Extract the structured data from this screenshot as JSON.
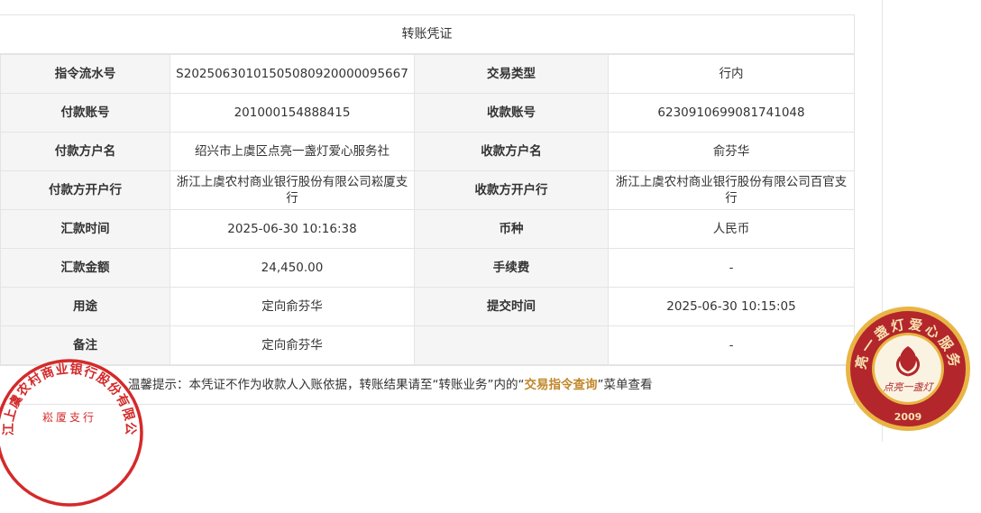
{
  "title": "转账凭证",
  "rows": [
    {
      "l1": "指令流水号",
      "v1": "S20250630101505080920000095667",
      "l2": "交易类型",
      "v2": "行内"
    },
    {
      "l1": "付款账号",
      "v1": "201000154888415",
      "l2": "收款账号",
      "v2": "6230910699081741048"
    },
    {
      "l1": "付款方户名",
      "v1": "绍兴市上虞区点亮一盏灯爱心服务社",
      "l2": "收款方户名",
      "v2": "俞芬华"
    },
    {
      "l1": "付款方开户行",
      "v1": "浙江上虞农村商业银行股份有限公司崧厦支行",
      "l2": "收款方开户行",
      "v2": "浙江上虞农村商业银行股份有限公司百官支行"
    },
    {
      "l1": "汇款时间",
      "v1": "2025-06-30 10:16:38",
      "l2": "币种",
      "v2": "人民币"
    },
    {
      "l1": "汇款金额",
      "v1": "24,450.00",
      "l2": "手续费",
      "v2": "-"
    },
    {
      "l1": "用途",
      "v1": "定向俞芬华",
      "l2": "提交时间",
      "v2": "2025-06-30 10:15:05"
    },
    {
      "l1": "备注",
      "v1": "定向俞芬华",
      "l2": "",
      "v2": "-"
    }
  ],
  "tip": {
    "prefix": "温馨提示：本凭证不作为收款人入账依据，转账结果请至“转账业务”内的“",
    "link": "交易指令查询",
    "suffix": "”菜单查看"
  },
  "stamps": {
    "bank": {
      "text": "浙江上虞农村商业银行股份有限公司",
      "sub": "崧厦支行",
      "color": "#d42a2a"
    },
    "org": {
      "text": "点亮一盏灯爱心服务社",
      "center": "点亮一盏灯",
      "year": "2009",
      "color": "#b3262b",
      "gold": "#e8b544"
    }
  }
}
